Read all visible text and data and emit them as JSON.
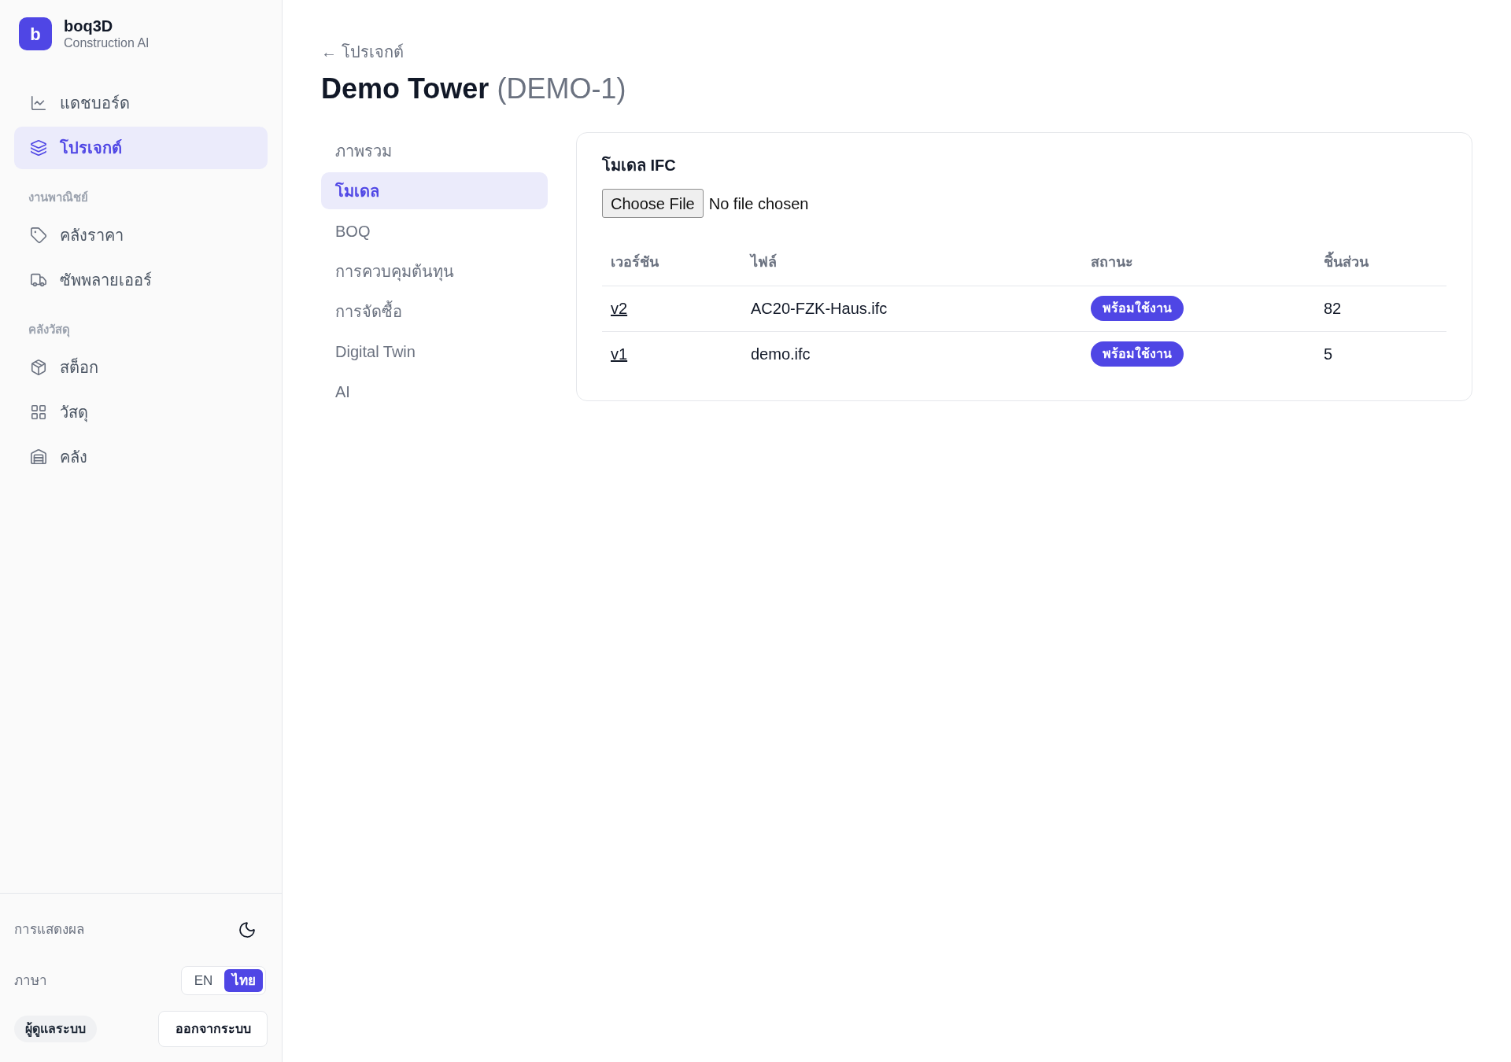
{
  "sidebar": {
    "brand": {
      "logo_letter": "b",
      "name": "boq3D",
      "tagline": "Construction AI"
    },
    "groups": [
      {
        "items": [
          {
            "label": "แดชบอร์ด",
            "selected": false
          },
          {
            "label": "โปรเจกต์",
            "selected": true
          }
        ]
      },
      {
        "heading": "งานพาณิชย์",
        "items": [
          {
            "label": "คลังราคา",
            "selected": false
          },
          {
            "label": "ซัพพลายเออร์",
            "selected": false
          }
        ]
      },
      {
        "heading": "คลังวัสดุ",
        "items": [
          {
            "label": "สต็อก",
            "selected": false
          },
          {
            "label": "วัสดุ",
            "selected": false
          },
          {
            "label": "คลัง",
            "selected": false
          }
        ]
      }
    ],
    "display": {
      "label": "การแสดงผล"
    },
    "language": {
      "label": "ภาษา",
      "options": [
        {
          "label": "EN",
          "selected": false
        },
        {
          "label": "ไทย",
          "selected": true
        }
      ]
    },
    "user_role": "ผู้ดูแลระบบ",
    "logout_button": "ออกจากระบบ"
  },
  "main": {
    "back_link": "← โปรเจกต์",
    "title": {
      "name": "Demo Tower",
      "code": "(DEMO-1)"
    },
    "project_tabs": [
      {
        "label": "ภาพรวม",
        "selected": false
      },
      {
        "label": "โมเดล",
        "selected": true
      },
      {
        "label": "BOQ",
        "selected": false
      },
      {
        "label": "การควบคุมต้นทุน",
        "selected": false
      },
      {
        "label": "การจัดซื้อ",
        "selected": false
      },
      {
        "label": "Digital Twin",
        "selected": false
      },
      {
        "label": "AI",
        "selected": false
      }
    ],
    "model_card": {
      "title": "โมเดล IFC",
      "file_input": {
        "button": "Choose File",
        "status": "No file chosen"
      },
      "table": {
        "columns": [
          "เวอร์ชัน",
          "ไฟล์",
          "สถานะ",
          "ชิ้นส่วน"
        ],
        "rows": [
          {
            "version": "v2",
            "file": "AC20-FZK-Haus.ifc",
            "status": "พร้อมใช้งาน",
            "parts": "82"
          },
          {
            "version": "v1",
            "file": "demo.ifc",
            "status": "พร้อมใช้งาน",
            "parts": "5"
          }
        ]
      }
    }
  }
}
